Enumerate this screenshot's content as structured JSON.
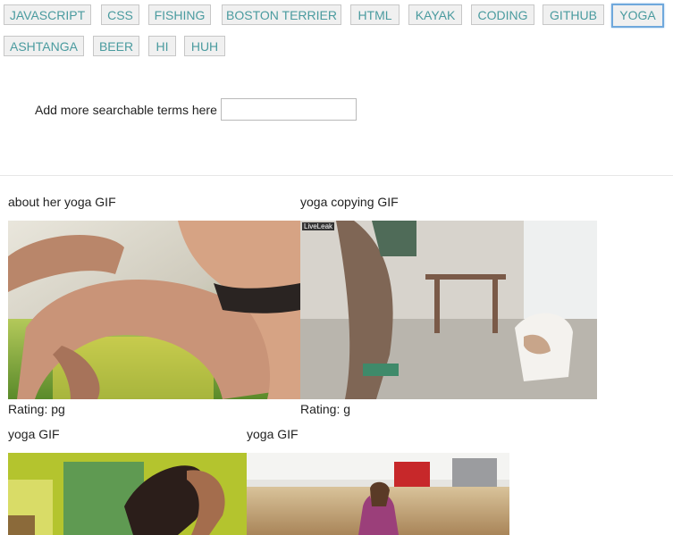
{
  "tags": [
    "JAVASCRIPT",
    "CSS",
    "FISHING",
    "BOSTON TERRIER",
    "HTML",
    "KAYAK",
    "CODING",
    "GITHUB",
    "YOGA",
    "ASHTANGA",
    "BEER",
    "HI",
    "HUH"
  ],
  "active_tag": "YOGA",
  "search": {
    "label": "Add more searchable terms here",
    "value": "",
    "placeholder": ""
  },
  "gifs": [
    {
      "title": "about her yoga GIF",
      "rating": "Rating: pg"
    },
    {
      "title": "yoga copying GIF",
      "rating": "Rating: g",
      "watermark": "LiveLeak"
    },
    {
      "title": "yoga GIF",
      "rating": ""
    },
    {
      "title": "yoga GIF",
      "rating": ""
    }
  ]
}
